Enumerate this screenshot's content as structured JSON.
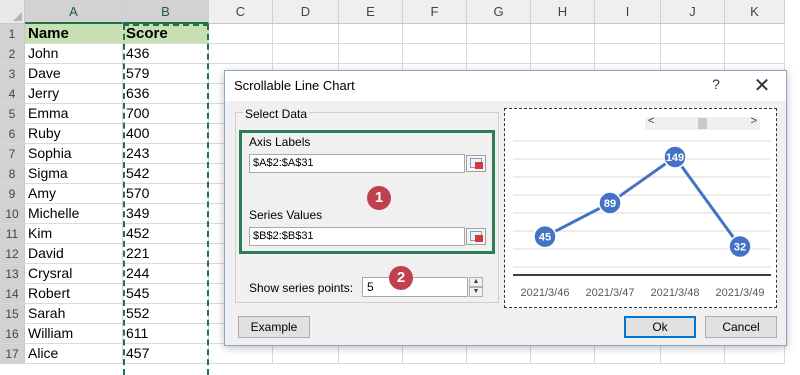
{
  "sheet": {
    "columns": [
      "A",
      "B",
      "C",
      "D",
      "E",
      "F",
      "G",
      "H",
      "I",
      "J",
      "K"
    ],
    "rows": [
      {
        "num": "1",
        "a": "Name",
        "b": "Score"
      },
      {
        "num": "2",
        "a": "John",
        "b": "436"
      },
      {
        "num": "3",
        "a": "Dave",
        "b": "579"
      },
      {
        "num": "4",
        "a": "Jerry",
        "b": "636"
      },
      {
        "num": "5",
        "a": "Emma",
        "b": "700"
      },
      {
        "num": "6",
        "a": "Ruby",
        "b": "400"
      },
      {
        "num": "7",
        "a": "Sophia",
        "b": "243"
      },
      {
        "num": "8",
        "a": "Sigma",
        "b": "542"
      },
      {
        "num": "9",
        "a": "Amy",
        "b": "570"
      },
      {
        "num": "10",
        "a": "Michelle",
        "b": "349"
      },
      {
        "num": "11",
        "a": "Kim",
        "b": "452"
      },
      {
        "num": "12",
        "a": "David",
        "b": "221"
      },
      {
        "num": "13",
        "a": "Crysral",
        "b": "244"
      },
      {
        "num": "14",
        "a": "Robert",
        "b": "545"
      },
      {
        "num": "15",
        "a": "Sarah",
        "b": "552"
      },
      {
        "num": "16",
        "a": "William",
        "b": "611"
      },
      {
        "num": "17",
        "a": "Alice",
        "b": "457"
      }
    ],
    "header_fill": "#c6e0b4",
    "marquee_color": "#217346"
  },
  "dialog": {
    "title": "Scrollable Line Chart",
    "help": "?",
    "close": "✕",
    "group_title": "Select Data",
    "axis_labels_label": "Axis Labels",
    "axis_labels_value": "$A$2:$A$31",
    "series_values_label": "Series Values",
    "series_values_value": "$B$2:$B$31",
    "show_points_label": "Show series points:",
    "show_points_value": "5",
    "badge_1": "1",
    "badge_2": "2",
    "example_button": "Example",
    "ok_button": "Ok",
    "cancel_button": "Cancel",
    "scroll_left": "<",
    "scroll_right": ">"
  },
  "chart_data": {
    "type": "line",
    "categories": [
      "2021/3/46",
      "2021/3/47",
      "2021/3/48",
      "2021/3/49"
    ],
    "values": [
      45,
      89,
      149,
      32
    ],
    "data_labels": [
      "45",
      "89",
      "149",
      "32"
    ],
    "ylim": [
      0,
      170
    ],
    "grid": true,
    "line_color": "#4472c4",
    "marker_color": "#4472c4"
  }
}
